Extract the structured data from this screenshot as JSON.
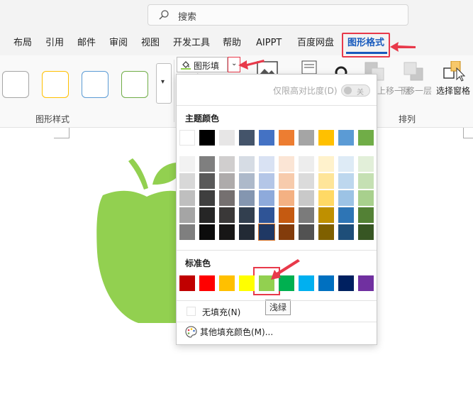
{
  "search": {
    "placeholder": "搜索"
  },
  "tabs": [
    {
      "label": "布局"
    },
    {
      "label": "引用"
    },
    {
      "label": "邮件"
    },
    {
      "label": "审阅"
    },
    {
      "label": "视图"
    },
    {
      "label": "开发工具"
    },
    {
      "label": "帮助"
    },
    {
      "label": "AIPPT"
    },
    {
      "label": "百度网盘"
    },
    {
      "label": "图形格式"
    }
  ],
  "ribbon": {
    "shape_fill_label": "图形填充",
    "bring_forward_label": "上移一层",
    "send_backward_label": "下移一层",
    "selection_pane_label": "选择窗格",
    "group_style_label": "图形样式",
    "group_arrange_label": "排列"
  },
  "popup": {
    "contrast_label": "仅限高对比度(D)",
    "contrast_toggle_state": "关",
    "theme_colors_title": "主题颜色",
    "standard_colors_title": "标准色",
    "no_fill_label": "无填充(N)",
    "more_colors_label": "其他填充颜色(M)...",
    "tooltip": "浅绿",
    "theme_top_row": [
      "#ffffff",
      "#000000",
      "#e7e6e6",
      "#44546a",
      "#4472c4",
      "#ed7d31",
      "#a5a5a5",
      "#ffc000",
      "#5b9bd5",
      "#70ad47"
    ],
    "theme_shades": [
      [
        "#f2f2f2",
        "#7f7f7f",
        "#d0cece",
        "#d6dce4",
        "#d9e2f3",
        "#fbe5d5",
        "#ededed",
        "#fff2cc",
        "#deebf6",
        "#e2efd9"
      ],
      [
        "#d8d8d8",
        "#595959",
        "#aeabab",
        "#adb9ca",
        "#b4c6e7",
        "#f7cbac",
        "#dbdbdb",
        "#fee599",
        "#bdd7ee",
        "#c5e0b3"
      ],
      [
        "#bfbfbf",
        "#3f3f3f",
        "#757070",
        "#8496b0",
        "#8eaadb",
        "#f4b183",
        "#c9c9c9",
        "#ffd965",
        "#9cc3e5",
        "#a8d08d"
      ],
      [
        "#a5a5a5",
        "#262626",
        "#3a3838",
        "#323f4f",
        "#2f5496",
        "#c55a11",
        "#7b7b7b",
        "#bf9000",
        "#2e75b5",
        "#538135"
      ],
      [
        "#7f7f7f",
        "#0c0c0c",
        "#171616",
        "#222a35",
        "#1f3864",
        "#833c0b",
        "#525252",
        "#7f6000",
        "#1e4e79",
        "#375623"
      ]
    ],
    "selected_theme_swatch": "#1f3864",
    "standard_colors": [
      "#c00000",
      "#ff0000",
      "#ffc000",
      "#ffff00",
      "#92d050",
      "#00b050",
      "#00b0f0",
      "#0070c0",
      "#002060",
      "#7030a0"
    ]
  },
  "colors": {
    "apple": "#92d050",
    "accent": "#185abd",
    "annotation": "#e8394a"
  },
  "icons": [
    "search-icon",
    "paint-bucket-icon",
    "chevron-down-icon",
    "picture-icon",
    "bring-forward-icon",
    "send-backward-icon",
    "selection-pane-icon",
    "palette-icon",
    "more-gallery-icon"
  ]
}
